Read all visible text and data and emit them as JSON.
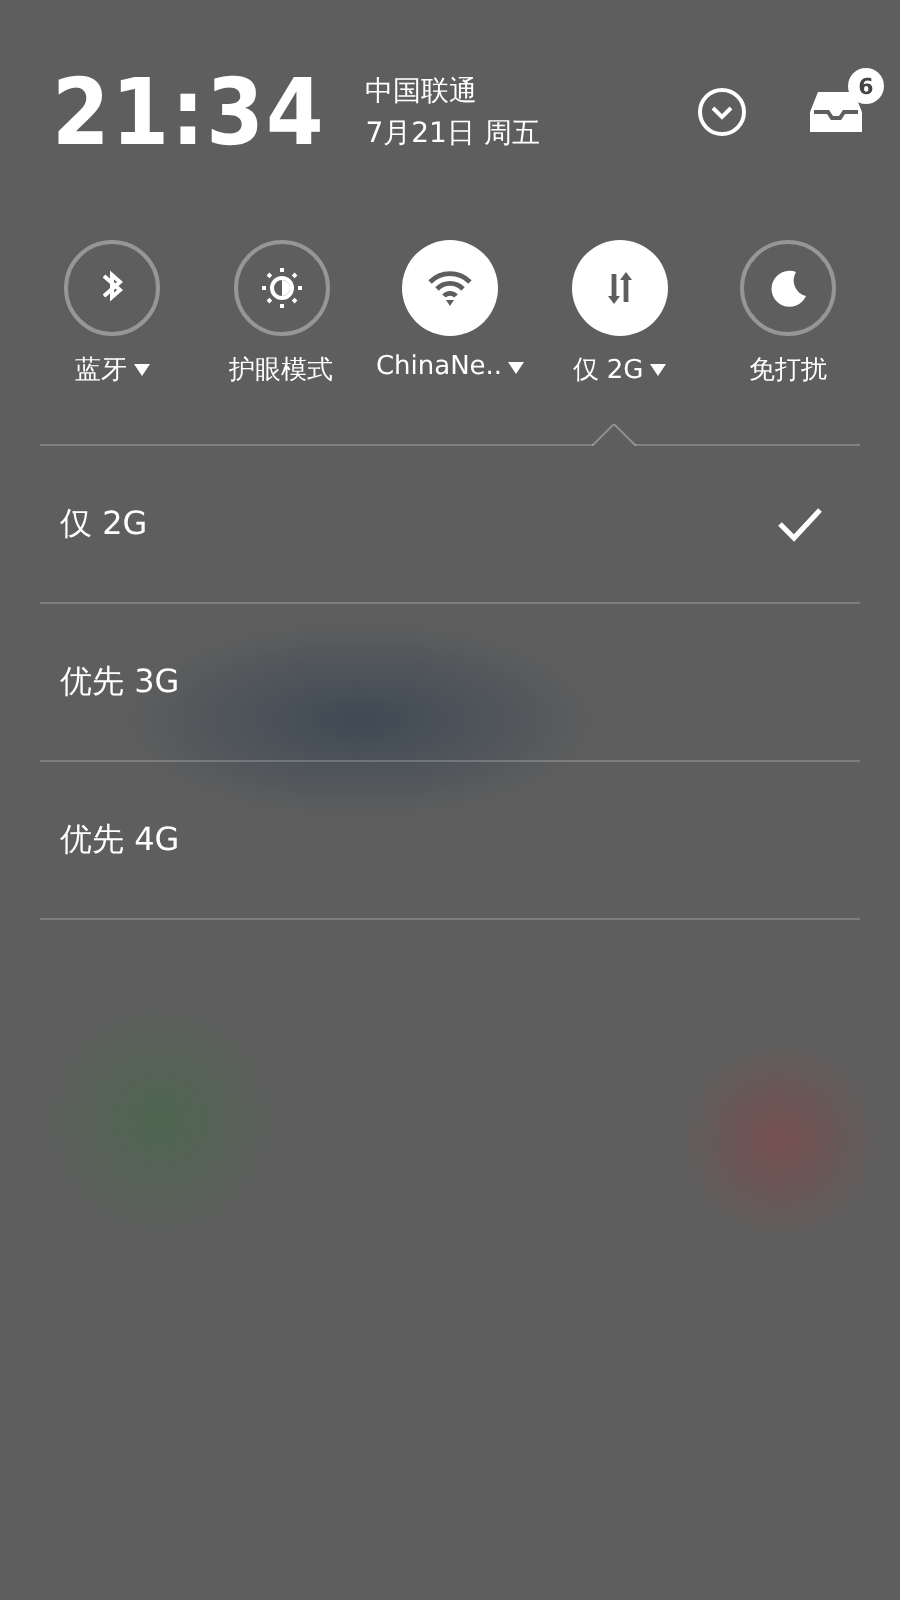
{
  "header": {
    "time": "21:34",
    "carrier": "中国联通",
    "date": "7月21日 周五",
    "notification_count": "6"
  },
  "toggles": [
    {
      "kind": "bluetooth",
      "label": "蓝牙",
      "on": false,
      "has_menu": true,
      "selected": false
    },
    {
      "kind": "eye",
      "label": "护眼模式",
      "on": false,
      "has_menu": false,
      "selected": false
    },
    {
      "kind": "wifi",
      "label": "ChinaNe..",
      "on": true,
      "has_menu": true,
      "selected": false
    },
    {
      "kind": "data",
      "label": "仅 2G",
      "on": true,
      "has_menu": true,
      "selected": true
    },
    {
      "kind": "moon",
      "label": "免打扰",
      "on": false,
      "has_menu": false,
      "selected": false
    }
  ],
  "network_options": [
    {
      "label": "仅 2G",
      "selected": true
    },
    {
      "label": "优先 3G",
      "selected": false
    },
    {
      "label": "优先 4G",
      "selected": false
    }
  ]
}
